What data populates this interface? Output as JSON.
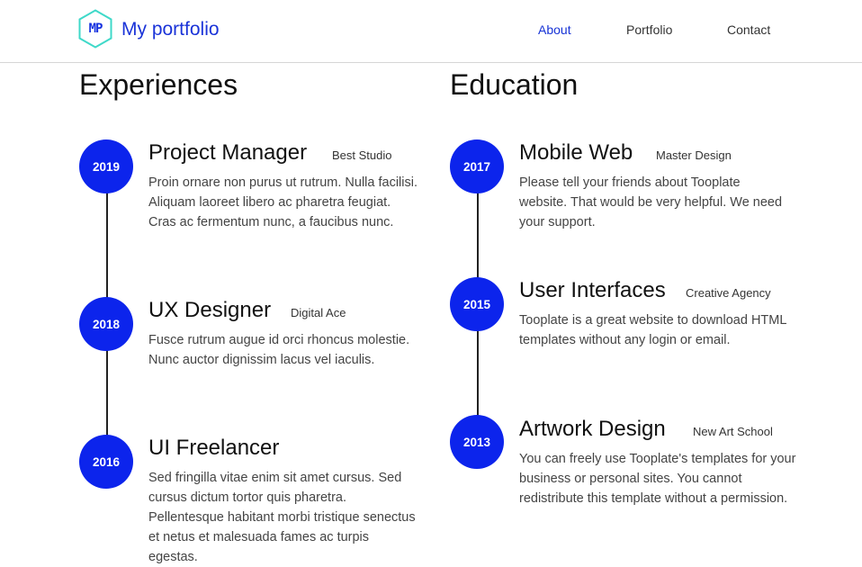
{
  "header": {
    "logo_text": "MP",
    "brand": "My portfolio",
    "nav": [
      {
        "label": "About",
        "active": true
      },
      {
        "label": "Portfolio",
        "active": false
      },
      {
        "label": "Contact",
        "active": false
      }
    ]
  },
  "experiences": {
    "title": "Experiences",
    "items": [
      {
        "year": "2019",
        "title": "Project Manager",
        "org": "Best Studio",
        "desc": "Proin ornare non purus ut rutrum. Nulla facilisi. Aliquam laoreet libero ac pharetra feugiat. Cras ac fermentum nunc, a faucibus nunc."
      },
      {
        "year": "2018",
        "title": "UX Designer",
        "org": "Digital Ace",
        "desc": "Fusce rutrum augue id orci rhoncus molestie. Nunc auctor dignissim lacus vel iaculis."
      },
      {
        "year": "2016",
        "title": "UI Freelancer",
        "org": "",
        "desc": "Sed fringilla vitae enim sit amet cursus. Sed cursus dictum tortor quis pharetra. Pellentesque habitant morbi tristique senectus et netus et malesuada fames ac turpis egestas."
      }
    ]
  },
  "education": {
    "title": "Education",
    "items": [
      {
        "year": "2017",
        "title": "Mobile Web",
        "org": "Master Design",
        "desc": "Please tell your friends about Tooplate website. That would be very helpful. We need your support."
      },
      {
        "year": "2015",
        "title": "User Interfaces",
        "org": "Creative Agency",
        "desc": "Tooplate is a great website to download HTML templates without any login or email."
      },
      {
        "year": "2013",
        "title": "Artwork Design",
        "org": "New Art School",
        "desc": "You can freely use Tooplate's templates for your business or personal sites. You cannot redistribute this template without a permission."
      }
    ]
  },
  "colors": {
    "accent": "#0c24ec",
    "logo_outline": "#3fd9c9",
    "brand": "#1a33d8"
  }
}
